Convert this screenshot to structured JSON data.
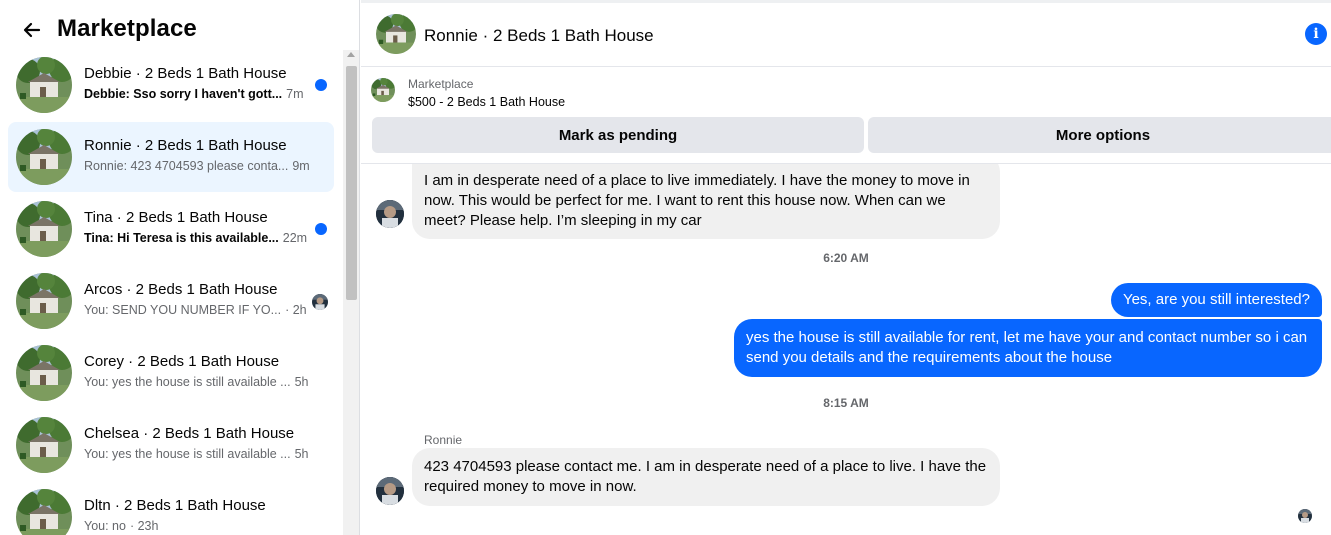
{
  "sidebar": {
    "back_label": "Back",
    "title": "Marketplace",
    "conversations": [
      {
        "name": "Debbie · 2 Beds 1 Bath House",
        "preview": "Debbie: Sso sorry I haven't gott...",
        "time": "7m",
        "unread": true,
        "status": "unread-dot"
      },
      {
        "name": "Ronnie · 2 Beds 1 Bath House",
        "preview": "Ronnie: 423 4704593 please conta...",
        "time": "9m",
        "unread": false,
        "status": "none"
      },
      {
        "name": "Tina · 2 Beds 1 Bath House",
        "preview": "Tina: Hi Teresa is this available...",
        "time": "22m",
        "unread": true,
        "status": "unread-dot"
      },
      {
        "name": "Arcos · 2 Beds 1 Bath House",
        "preview": "You: SEND YOU NUMBER IF YO...",
        "time": "· 2h",
        "unread": false,
        "status": "seen-avatar"
      },
      {
        "name": "Corey · 2 Beds 1 Bath House",
        "preview": "You: yes the house is still available ...",
        "time": "5h",
        "unread": false,
        "status": "none"
      },
      {
        "name": "Chelsea · 2 Beds 1 Bath House",
        "preview": "You: yes the house is still available ...",
        "time": "5h",
        "unread": false,
        "status": "none"
      },
      {
        "name": "Dltn · 2 Beds 1 Bath House",
        "preview": "You: no",
        "time": "· 23h",
        "unread": false,
        "status": "none"
      }
    ]
  },
  "header": {
    "title": "Ronnie · 2 Beds 1 Bath House",
    "info_icon": "info-icon"
  },
  "listing": {
    "label": "Marketplace",
    "price_title": "$500 - 2 Beds 1 Bath House",
    "mark_pending_label": "Mark as pending",
    "more_options_label": "More options"
  },
  "messages": {
    "msg1": "I am in desperate need of a place to live immediately. I have the money to move in now. This would be perfect for me. I want to rent this house now. When can we meet? Please help. I’m sleeping in my car",
    "time1": "6:20 AM",
    "out1": "Yes, are you still interested?",
    "out2": "yes the house is still available for rent, let me have your and contact number so i can send you details and the requirements about the house",
    "time2": "8:15 AM",
    "sender": "Ronnie",
    "msg2": "423 4704593 please contact me. I am in desperate need of a place to live. I have the required money to move in now."
  },
  "colors": {
    "accent": "#0866ff",
    "active_bg": "#ebf5ff",
    "bubble_in": "#f0f0f0",
    "secondary_text": "#65676b"
  }
}
